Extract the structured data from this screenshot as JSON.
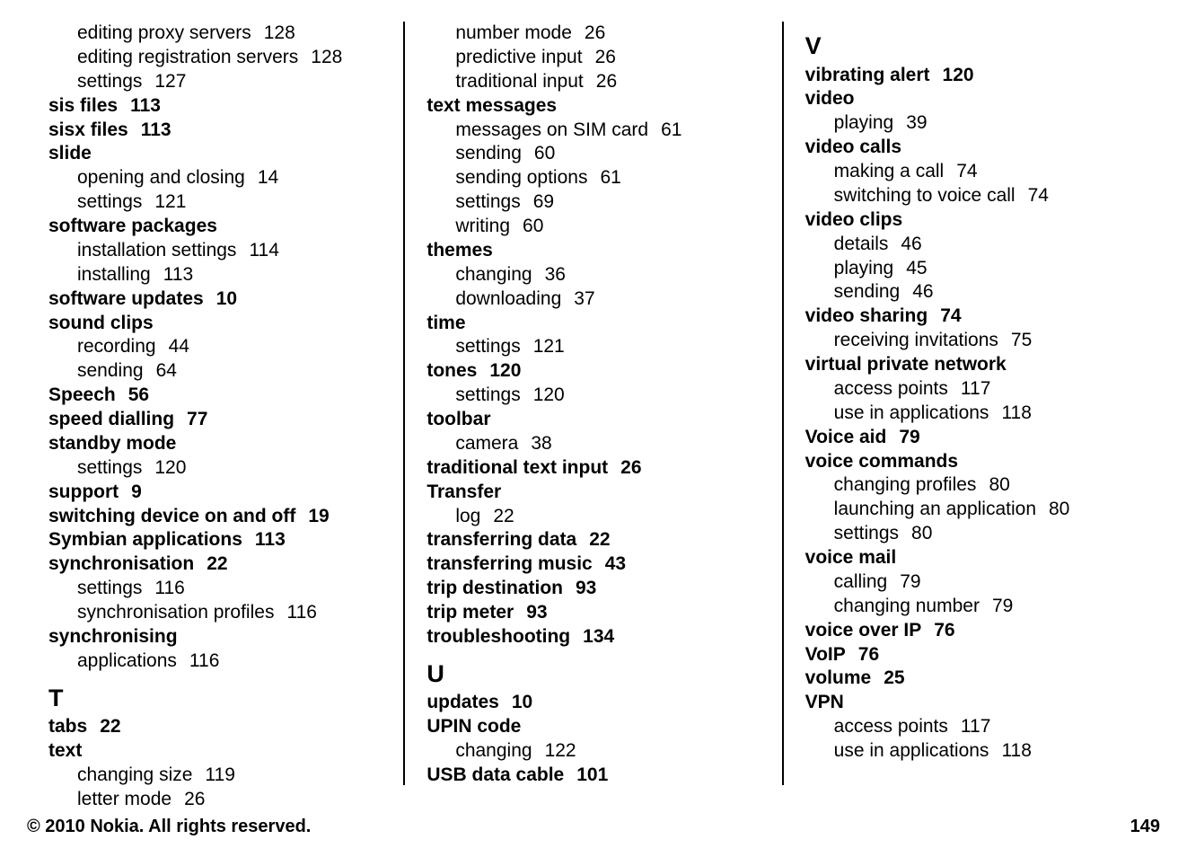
{
  "footer": {
    "copyright": "© 2010 Nokia. All rights reserved.",
    "page": "149"
  },
  "col1": [
    {
      "t": "sub",
      "text": "editing proxy servers",
      "page": "128"
    },
    {
      "t": "sub",
      "text": "editing registration servers",
      "page": "128"
    },
    {
      "t": "sub",
      "text": "settings",
      "page": "127"
    },
    {
      "t": "topic",
      "text": "sis files",
      "page": "113"
    },
    {
      "t": "topic",
      "text": "sisx files",
      "page": "113"
    },
    {
      "t": "topic",
      "text": "slide"
    },
    {
      "t": "sub",
      "text": "opening and closing",
      "page": "14"
    },
    {
      "t": "sub",
      "text": "settings",
      "page": "121"
    },
    {
      "t": "topic",
      "text": "software packages"
    },
    {
      "t": "sub",
      "text": "installation settings",
      "page": "114"
    },
    {
      "t": "sub",
      "text": "installing",
      "page": "113"
    },
    {
      "t": "topic",
      "text": "software updates",
      "page": "10"
    },
    {
      "t": "topic",
      "text": "sound clips"
    },
    {
      "t": "sub",
      "text": "recording",
      "page": "44"
    },
    {
      "t": "sub",
      "text": "sending",
      "page": "64"
    },
    {
      "t": "topic",
      "text": "Speech",
      "page": "56"
    },
    {
      "t": "topic",
      "text": "speed dialling",
      "page": "77"
    },
    {
      "t": "topic",
      "text": "standby mode"
    },
    {
      "t": "sub",
      "text": "settings",
      "page": "120"
    },
    {
      "t": "topic",
      "text": "support",
      "page": "9"
    },
    {
      "t": "topic",
      "text": "switching device on and off",
      "page": "19"
    },
    {
      "t": "topic",
      "text": "Symbian applications",
      "page": "113"
    },
    {
      "t": "topic",
      "text": "synchronisation",
      "page": "22"
    },
    {
      "t": "sub",
      "text": "settings",
      "page": "116"
    },
    {
      "t": "sub",
      "text": "synchronisation profiles",
      "page": "116"
    },
    {
      "t": "topic",
      "text": "synchronising"
    },
    {
      "t": "sub",
      "text": "applications",
      "page": "116"
    },
    {
      "t": "letter",
      "text": "T"
    },
    {
      "t": "topic",
      "text": "tabs",
      "page": "22"
    },
    {
      "t": "topic",
      "text": "text"
    },
    {
      "t": "sub",
      "text": "changing size",
      "page": "119"
    },
    {
      "t": "sub",
      "text": "letter mode",
      "page": "26"
    }
  ],
  "col2": [
    {
      "t": "sub",
      "text": "number mode",
      "page": "26"
    },
    {
      "t": "sub",
      "text": "predictive input",
      "page": "26"
    },
    {
      "t": "sub",
      "text": "traditional input",
      "page": "26"
    },
    {
      "t": "topic",
      "text": "text messages"
    },
    {
      "t": "sub",
      "text": "messages on SIM card",
      "page": "61"
    },
    {
      "t": "sub",
      "text": "sending",
      "page": "60"
    },
    {
      "t": "sub",
      "text": "sending options",
      "page": "61"
    },
    {
      "t": "sub",
      "text": "settings",
      "page": "69"
    },
    {
      "t": "sub",
      "text": "writing",
      "page": "60"
    },
    {
      "t": "topic",
      "text": "themes"
    },
    {
      "t": "sub",
      "text": "changing",
      "page": "36"
    },
    {
      "t": "sub",
      "text": "downloading",
      "page": "37"
    },
    {
      "t": "topic",
      "text": "time"
    },
    {
      "t": "sub",
      "text": "settings",
      "page": "121"
    },
    {
      "t": "topic",
      "text": "tones",
      "page": "120"
    },
    {
      "t": "sub",
      "text": "settings",
      "page": "120"
    },
    {
      "t": "topic",
      "text": "toolbar"
    },
    {
      "t": "sub",
      "text": "camera",
      "page": "38"
    },
    {
      "t": "topic",
      "text": "traditional text input",
      "page": "26"
    },
    {
      "t": "topic",
      "text": "Transfer"
    },
    {
      "t": "sub",
      "text": "log",
      "page": "22"
    },
    {
      "t": "topic",
      "text": "transferring data",
      "page": "22"
    },
    {
      "t": "topic",
      "text": "transferring music",
      "page": "43"
    },
    {
      "t": "topic",
      "text": "trip destination",
      "page": "93"
    },
    {
      "t": "topic",
      "text": "trip meter",
      "page": "93"
    },
    {
      "t": "topic",
      "text": "troubleshooting",
      "page": "134"
    },
    {
      "t": "letter",
      "text": "U"
    },
    {
      "t": "topic",
      "text": "updates",
      "page": "10"
    },
    {
      "t": "topic",
      "text": "UPIN code"
    },
    {
      "t": "sub",
      "text": "changing",
      "page": "122"
    },
    {
      "t": "topic",
      "text": "USB data cable",
      "page": "101"
    }
  ],
  "col3": [
    {
      "t": "letter",
      "text": "V"
    },
    {
      "t": "topic",
      "text": "vibrating alert",
      "page": "120"
    },
    {
      "t": "topic",
      "text": "video"
    },
    {
      "t": "sub",
      "text": "playing",
      "page": "39"
    },
    {
      "t": "topic",
      "text": "video calls"
    },
    {
      "t": "sub",
      "text": "making a call",
      "page": "74"
    },
    {
      "t": "sub",
      "text": "switching to voice call",
      "page": "74"
    },
    {
      "t": "topic",
      "text": "video clips"
    },
    {
      "t": "sub",
      "text": "details",
      "page": "46"
    },
    {
      "t": "sub",
      "text": "playing",
      "page": "45"
    },
    {
      "t": "sub",
      "text": "sending",
      "page": "46"
    },
    {
      "t": "topic",
      "text": "video sharing",
      "page": "74"
    },
    {
      "t": "sub",
      "text": "receiving invitations",
      "page": "75"
    },
    {
      "t": "topic",
      "text": "virtual private network"
    },
    {
      "t": "sub",
      "text": "access points",
      "page": "117"
    },
    {
      "t": "sub",
      "text": "use in applications",
      "page": "118"
    },
    {
      "t": "topic",
      "text": "Voice aid",
      "page": "79"
    },
    {
      "t": "topic",
      "text": "voice commands"
    },
    {
      "t": "sub",
      "text": "changing profiles",
      "page": "80"
    },
    {
      "t": "sub",
      "text": "launching an application",
      "page": "80"
    },
    {
      "t": "sub",
      "text": "settings",
      "page": "80"
    },
    {
      "t": "topic",
      "text": "voice mail"
    },
    {
      "t": "sub",
      "text": "calling",
      "page": "79"
    },
    {
      "t": "sub",
      "text": "changing number",
      "page": "79"
    },
    {
      "t": "topic",
      "text": "voice over IP",
      "page": "76"
    },
    {
      "t": "topic",
      "text": "VoIP",
      "page": "76"
    },
    {
      "t": "topic",
      "text": "volume",
      "page": "25"
    },
    {
      "t": "topic",
      "text": "VPN"
    },
    {
      "t": "sub",
      "text": "access points",
      "page": "117"
    },
    {
      "t": "sub",
      "text": "use in applications",
      "page": "118"
    }
  ]
}
